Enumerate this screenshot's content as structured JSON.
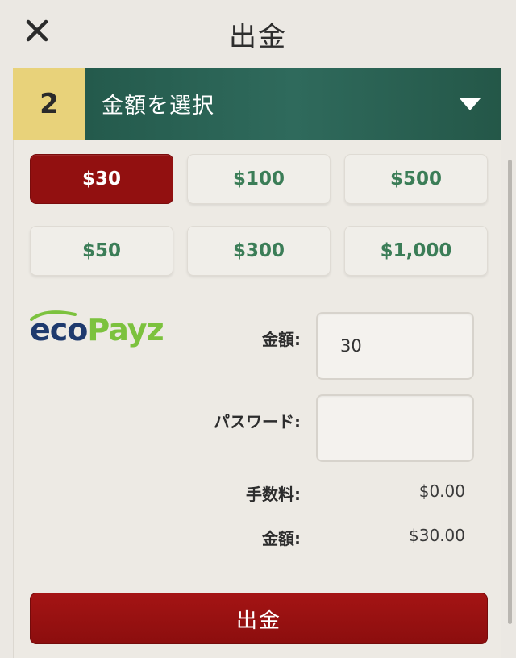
{
  "header": {
    "title": "出金",
    "close_icon": "close-icon"
  },
  "step": {
    "number": "2",
    "label": "金額を選択",
    "caret_icon": "caret-down-icon"
  },
  "amounts": [
    {
      "label": "$30",
      "selected": true
    },
    {
      "label": "$100",
      "selected": false
    },
    {
      "label": "$500",
      "selected": false
    },
    {
      "label": "$50",
      "selected": false
    },
    {
      "label": "$300",
      "selected": false
    },
    {
      "label": "$1,000",
      "selected": false
    }
  ],
  "logo": {
    "part1": "eco",
    "part2": "Payz"
  },
  "form": {
    "amount_label": "金額:",
    "amount_value": "30",
    "password_label": "パスワード:",
    "password_value": ""
  },
  "summary": {
    "fee_label": "手数料:",
    "fee_value": "$0.00",
    "total_label": "金額:",
    "total_value": "$30.00"
  },
  "submit": {
    "label": "出金"
  },
  "colors": {
    "accent_red": "#921010",
    "step_yellow": "#e8d27a",
    "step_green": "#2f6a5c",
    "amount_text_green": "#3b7d57",
    "logo_blue": "#1e3a6e",
    "logo_green": "#7cc23e"
  }
}
